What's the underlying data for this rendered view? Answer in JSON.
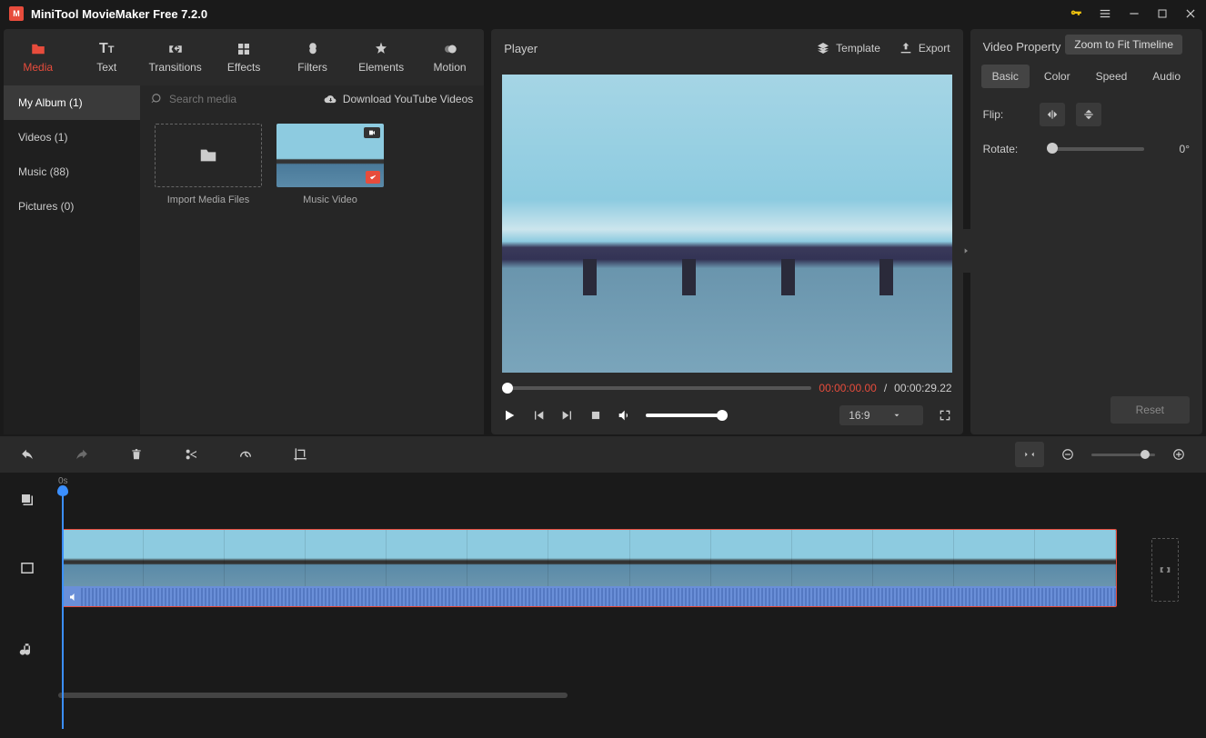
{
  "app": {
    "title": "MiniTool MovieMaker Free 7.2.0"
  },
  "tabs": {
    "media": "Media",
    "text": "Text",
    "transitions": "Transitions",
    "effects": "Effects",
    "filters": "Filters",
    "elements": "Elements",
    "motion": "Motion"
  },
  "sidebar": {
    "items": [
      {
        "label": "My Album (1)"
      },
      {
        "label": "Videos (1)"
      },
      {
        "label": "Music (88)"
      },
      {
        "label": "Pictures (0)"
      }
    ]
  },
  "media": {
    "searchPlaceholder": "Search media",
    "downloadYT": "Download YouTube Videos",
    "importLabel": "Import Media Files",
    "clipLabel": "Music Video"
  },
  "player": {
    "title": "Player",
    "template": "Template",
    "export": "Export",
    "timeCurrent": "00:00:00.00",
    "timeSep": "/",
    "timeTotal": "00:00:29.22",
    "aspect": "16:9"
  },
  "props": {
    "title": "Video Property",
    "tabs": {
      "basic": "Basic",
      "color": "Color",
      "speed": "Speed",
      "audio": "Audio"
    },
    "flip": "Flip:",
    "rotate": "Rotate:",
    "rotateVal": "0°",
    "reset": "Reset"
  },
  "timeline": {
    "rulerStart": "0s",
    "tooltip": "Zoom to Fit Timeline"
  }
}
